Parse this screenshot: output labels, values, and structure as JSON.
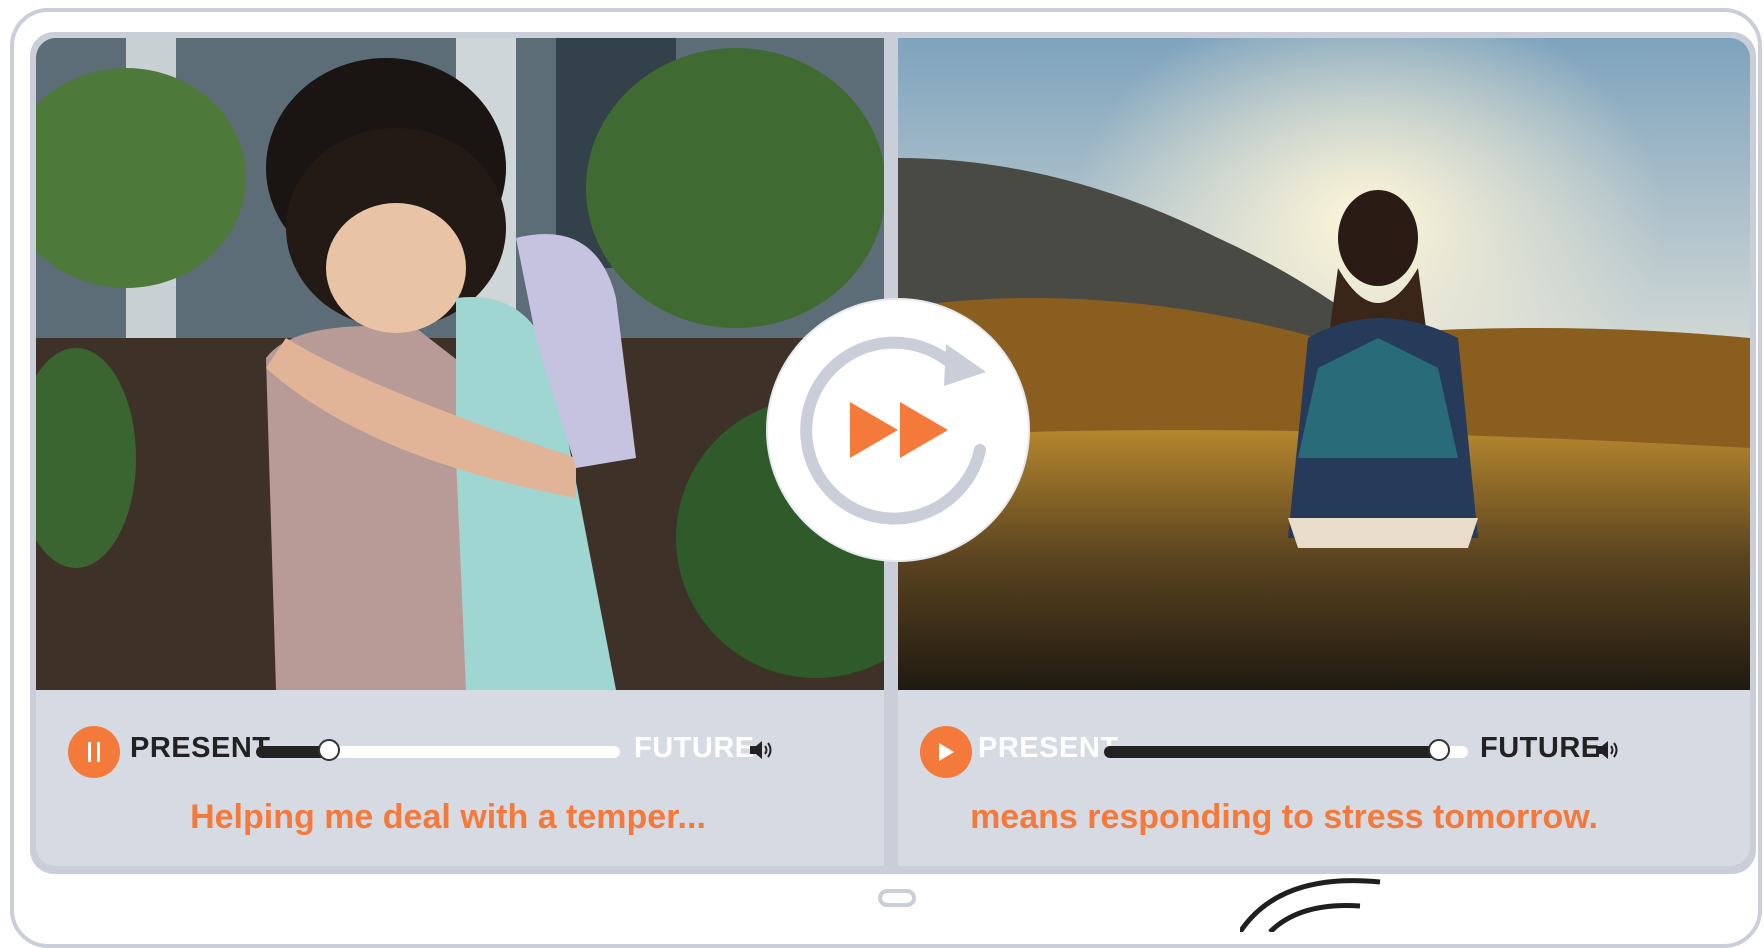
{
  "left_panel": {
    "state_left": "PRESENT",
    "state_right": "FUTURE",
    "progress": 0.2,
    "caption": "Helping me deal with a temper...",
    "button": "pause-icon"
  },
  "right_panel": {
    "state_left": "PRESENT",
    "state_right": "FUTURE",
    "progress": 0.92,
    "caption": "means responding to stress tomorrow.",
    "button": "play-icon"
  },
  "center_badge": {
    "icon": "fast-forward-replay-icon"
  },
  "colors": {
    "accent": "#f47a3c",
    "frame": "#c9ced9",
    "panel": "#d6dae3",
    "active_text": "#222222",
    "inactive_text": "#ffffff"
  }
}
